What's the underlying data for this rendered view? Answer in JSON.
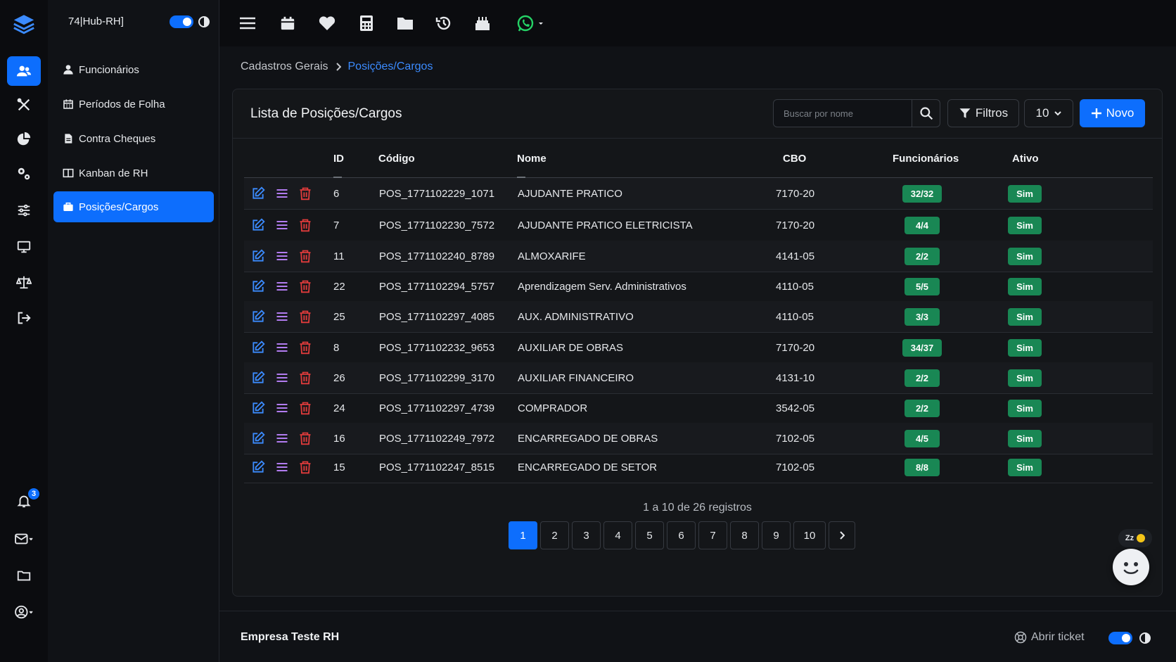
{
  "workspace": "74|Hub-RH]",
  "menu": [
    {
      "label": "Funcionários",
      "icon": "user-icon"
    },
    {
      "label": "Períodos de Folha",
      "icon": "calendar-icon"
    },
    {
      "label": "Contra Cheques",
      "icon": "file-icon"
    },
    {
      "label": "Kanban de RH",
      "icon": "kanban-icon"
    },
    {
      "label": "Posições/Cargos",
      "icon": "briefcase-icon",
      "active": true
    }
  ],
  "notifications_count": "3",
  "breadcrumb": {
    "parent": "Cadastros Gerais",
    "current": "Posições/Cargos"
  },
  "card": {
    "title": "Lista de Posições/Cargos",
    "search_placeholder": "Buscar por nome",
    "filters_label": "Filtros",
    "page_size": "10",
    "new_label": "Novo"
  },
  "columns": {
    "id": "ID",
    "codigo": "Código",
    "nome": "Nome",
    "cbo": "CBO",
    "funcionarios": "Funcionários",
    "ativo": "Ativo"
  },
  "rows": [
    {
      "id": "6",
      "codigo": "POS_1771102229_1071",
      "nome": "AJUDANTE PRATICO",
      "cbo": "7170-20",
      "funcionarios": "32/32",
      "ativo": "Sim"
    },
    {
      "id": "7",
      "codigo": "POS_1771102230_7572",
      "nome": "AJUDANTE PRATICO ELETRICISTA",
      "cbo": "7170-20",
      "funcionarios": "4/4",
      "ativo": "Sim"
    },
    {
      "id": "11",
      "codigo": "POS_1771102240_8789",
      "nome": "ALMOXARIFE",
      "cbo": "4141-05",
      "funcionarios": "2/2",
      "ativo": "Sim"
    },
    {
      "id": "22",
      "codigo": "POS_1771102294_5757",
      "nome": "Aprendizagem Serv. Administrativos",
      "cbo": "4110-05",
      "funcionarios": "5/5",
      "ativo": "Sim"
    },
    {
      "id": "25",
      "codigo": "POS_1771102297_4085",
      "nome": "AUX. ADMINISTRATIVO",
      "cbo": "4110-05",
      "funcionarios": "3/3",
      "ativo": "Sim"
    },
    {
      "id": "8",
      "codigo": "POS_1771102232_9653",
      "nome": "AUXILIAR DE OBRAS",
      "cbo": "7170-20",
      "funcionarios": "34/37",
      "ativo": "Sim"
    },
    {
      "id": "26",
      "codigo": "POS_1771102299_3170",
      "nome": "AUXILIAR FINANCEIRO",
      "cbo": "4131-10",
      "funcionarios": "2/2",
      "ativo": "Sim"
    },
    {
      "id": "24",
      "codigo": "POS_1771102297_4739",
      "nome": "COMPRADOR",
      "cbo": "3542-05",
      "funcionarios": "2/2",
      "ativo": "Sim"
    },
    {
      "id": "16",
      "codigo": "POS_1771102249_7972",
      "nome": "ENCARREGADO DE OBRAS",
      "cbo": "7102-05",
      "funcionarios": "4/5",
      "ativo": "Sim"
    },
    {
      "id": "15",
      "codigo": "POS_1771102247_8515",
      "nome": "ENCARREGADO DE SETOR",
      "cbo": "7102-05",
      "funcionarios": "8/8",
      "ativo": "Sim"
    }
  ],
  "pagination": {
    "info": "1 a 10 de 26 registros",
    "pages": [
      "1",
      "2",
      "3",
      "4",
      "5",
      "6",
      "7",
      "8",
      "9",
      "10"
    ],
    "current": "1"
  },
  "chat": {
    "status": "Zz"
  },
  "footer": {
    "company": "Empresa Teste RH",
    "ticket_label": "Abrir ticket"
  },
  "colors": {
    "accent": "#0d6efd",
    "success": "#198754",
    "danger": "#e03b3b",
    "purple": "#b27cf0",
    "link": "#3b8bff"
  }
}
